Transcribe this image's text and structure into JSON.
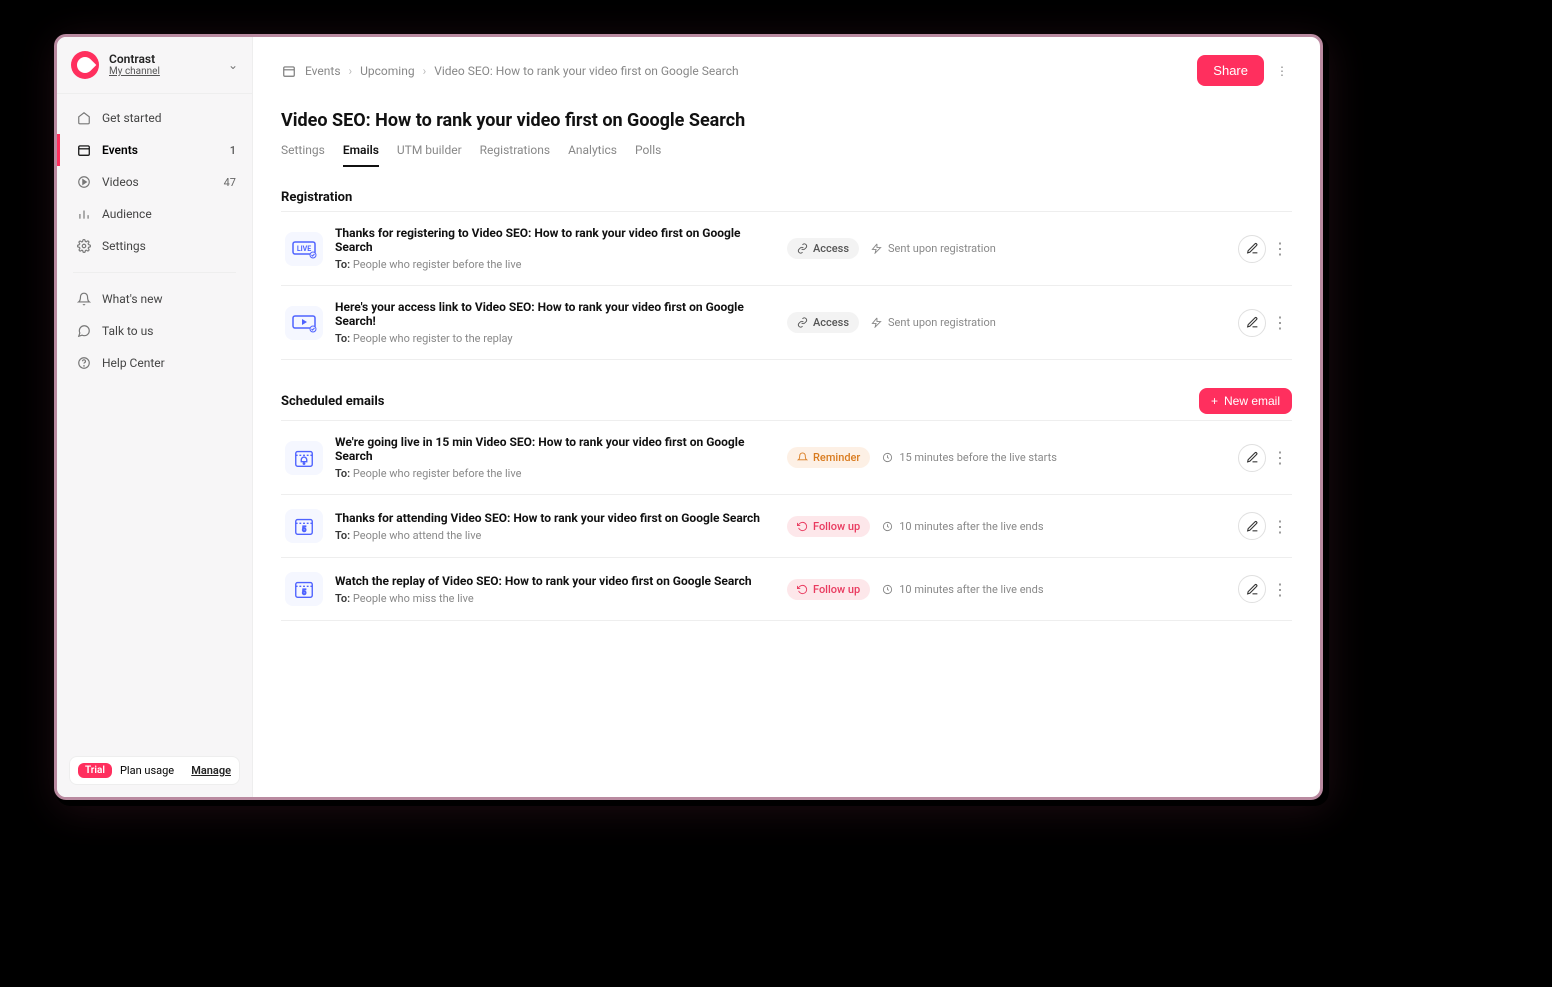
{
  "workspace": {
    "name": "Contrast",
    "subtitle": "My channel"
  },
  "sidebar": {
    "nav": [
      {
        "label": "Get started"
      },
      {
        "label": "Events",
        "badge": "1"
      },
      {
        "label": "Videos",
        "badge": "47"
      },
      {
        "label": "Audience"
      },
      {
        "label": "Settings"
      }
    ],
    "secondary": [
      {
        "label": "What's new"
      },
      {
        "label": "Talk to us"
      },
      {
        "label": "Help Center"
      }
    ],
    "plan": {
      "chip": "Trial",
      "label": "Plan usage",
      "manage": "Manage"
    }
  },
  "breadcrumb": {
    "items": [
      "Events",
      "Upcoming",
      "Video SEO: How to rank your video first on Google Search"
    ]
  },
  "header": {
    "title": "Video SEO: How to rank your video first on Google Search",
    "share": "Share"
  },
  "tabs": [
    {
      "label": "Settings"
    },
    {
      "label": "Emails",
      "active": true
    },
    {
      "label": "UTM builder"
    },
    {
      "label": "Registrations"
    },
    {
      "label": "Analytics"
    },
    {
      "label": "Polls"
    }
  ],
  "sections": {
    "registration": {
      "title": "Registration",
      "emails": [
        {
          "icon": "live",
          "subject": "Thanks for registering to Video SEO: How to rank your video first on Google Search",
          "to_prefix": "To:",
          "to": "People who register before the live",
          "chip": {
            "type": "access",
            "label": "Access"
          },
          "timing": "Sent upon registration"
        },
        {
          "icon": "play",
          "subject": "Here's your access link to Video SEO: How to rank your video first on Google Search!",
          "to_prefix": "To:",
          "to": "People who register to the replay",
          "chip": {
            "type": "access",
            "label": "Access"
          },
          "timing": "Sent upon registration"
        }
      ]
    },
    "scheduled": {
      "title": "Scheduled emails",
      "button": "New email",
      "emails": [
        {
          "icon": "cal-bell",
          "subject": "We're going live in 15 min Video SEO: How to rank your video first on Google Search",
          "to_prefix": "To:",
          "to": "People who register before the live",
          "chip": {
            "type": "reminder",
            "label": "Reminder"
          },
          "timing": "15 minutes before the live starts"
        },
        {
          "icon": "cal-5",
          "subject": "Thanks for attending Video SEO: How to rank your video first on Google Search",
          "to_prefix": "To:",
          "to": "People who attend the live",
          "chip": {
            "type": "followup",
            "label": "Follow up"
          },
          "timing": "10 minutes after the live ends"
        },
        {
          "icon": "cal-5",
          "subject": "Watch the replay of Video SEO: How to rank your video first on Google Search",
          "to_prefix": "To:",
          "to": "People who miss the live",
          "chip": {
            "type": "followup",
            "label": "Follow up"
          },
          "timing": "10 minutes after the live ends"
        }
      ]
    }
  }
}
